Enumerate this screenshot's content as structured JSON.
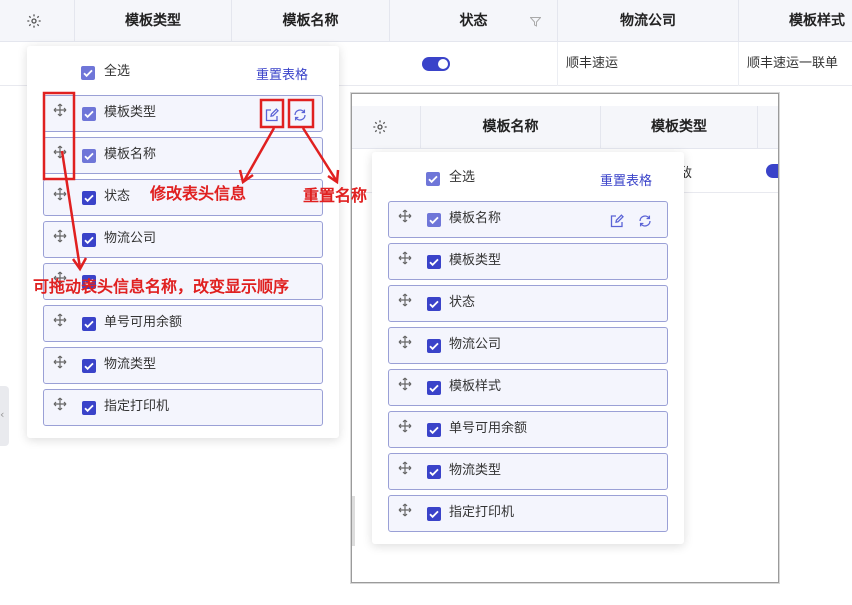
{
  "back_table": {
    "headers": [
      "模板类型",
      "模板名称",
      "状态",
      "物流公司",
      "模板样式"
    ],
    "row": {
      "company": "顺丰速运",
      "style": "顺丰速运一联单"
    }
  },
  "panel_left": {
    "select_all": "全选",
    "reset": "重置表格",
    "items": [
      "模板类型",
      "模板名称",
      "状态",
      "物流公司",
      "物流公司",
      "单号可用余额",
      "物流类型",
      "指定打印机"
    ]
  },
  "front_window": {
    "headers": [
      "模板名称",
      "模板类型"
    ],
    "row_partial": "敌",
    "select_all": "全选",
    "reset": "重置表格",
    "items": [
      "模板名称",
      "模板类型",
      "状态",
      "物流公司",
      "模板样式",
      "单号可用余额",
      "物流类型",
      "指定打印机"
    ]
  },
  "annotations": {
    "edit": "修改表头信息",
    "reset_name": "重置名称",
    "drag": "可拖动表头信息名称，改变显示顺序"
  },
  "colors": {
    "accent": "#3a43c9",
    "annotation": "#e02020",
    "item_bg": "#f4f5fd"
  }
}
